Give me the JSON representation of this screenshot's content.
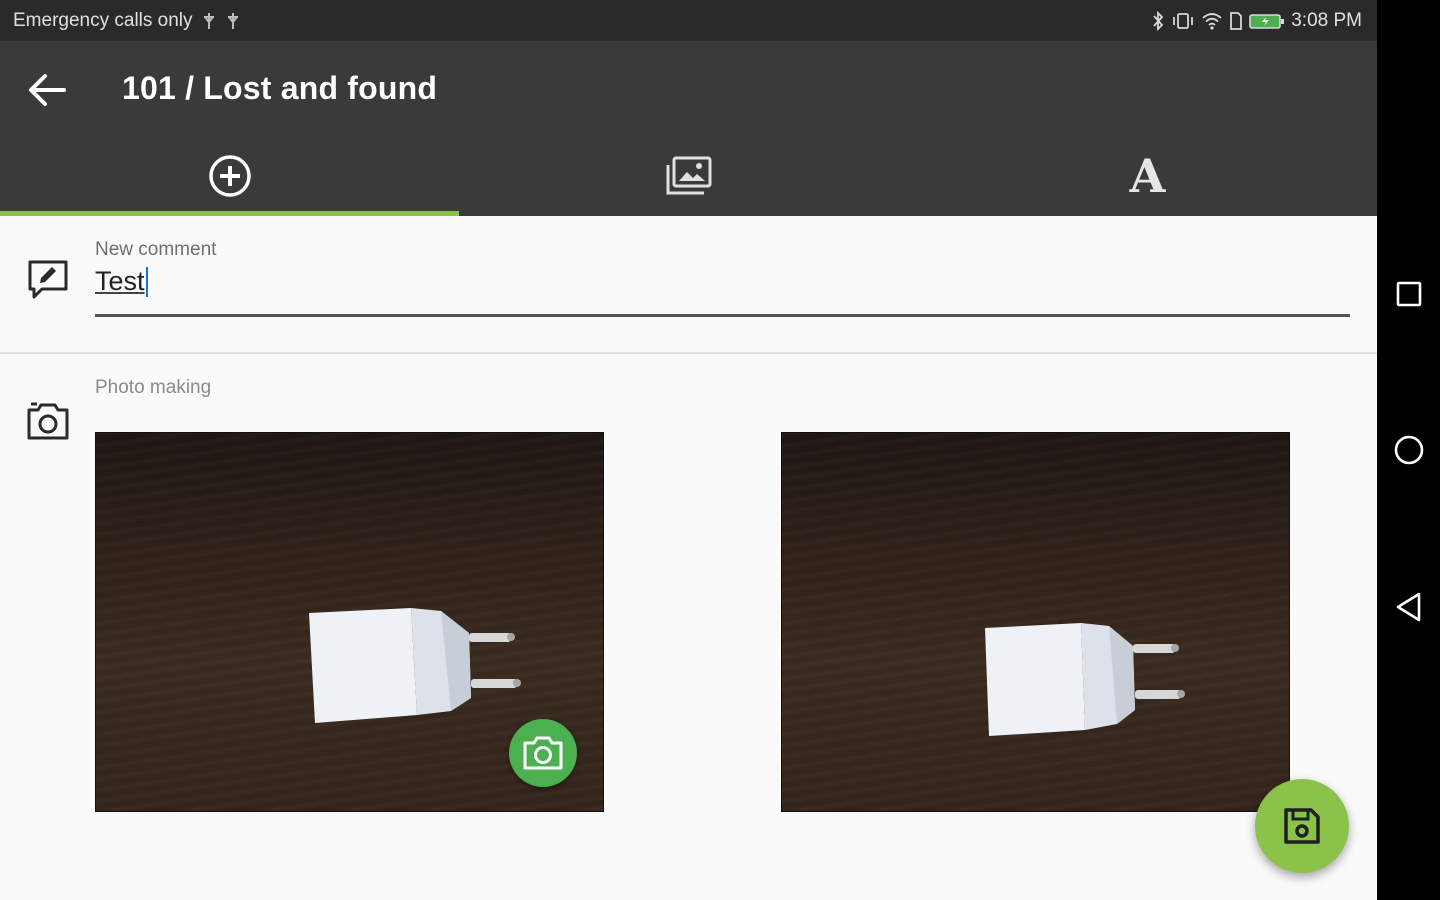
{
  "status_bar": {
    "carrier_text": "Emergency calls only",
    "time": "3:08 PM",
    "icons": [
      "signal-off-icon",
      "signal-off-icon",
      "bluetooth-icon",
      "vibrate-icon",
      "wifi-icon",
      "sim-icon",
      "battery-charging-icon"
    ]
  },
  "toolbar": {
    "title": "101 / Lost and found",
    "back_icon": "arrow-back-icon"
  },
  "tabs": [
    {
      "icon": "add-circle-icon",
      "active": true
    },
    {
      "icon": "photo-library-icon",
      "active": false
    },
    {
      "icon": "text-font-icon",
      "letter": "A",
      "active": false
    }
  ],
  "comment": {
    "label": "New comment",
    "value": "Test",
    "icon": "comment-edit-icon"
  },
  "photos": {
    "label": "Photo making",
    "icon": "camera-switch-icon",
    "count": 2,
    "content": "white-usb-charger-on-wood"
  },
  "fabs": {
    "camera_icon": "camera-icon",
    "save_icon": "save-icon"
  },
  "nav_bar": [
    "recents-square-icon",
    "home-circle-icon",
    "back-triangle-icon"
  ],
  "colors": {
    "accent": "#8bc34a",
    "camera_fab": "#4caf50",
    "toolbar": "#3a3a3a",
    "status_bar": "#2a2a2a",
    "background": "#fafafa"
  }
}
